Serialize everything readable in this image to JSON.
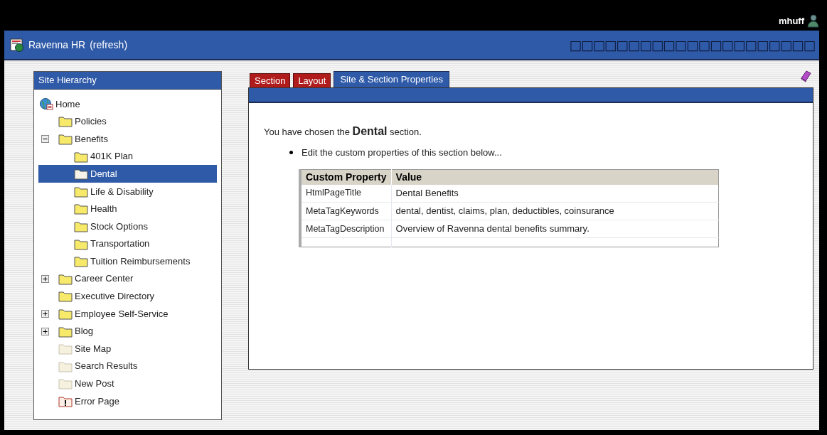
{
  "user": {
    "name": "mhuff"
  },
  "header": {
    "title": "Ravenna HR",
    "refresh_link": "(refresh)",
    "garbled_text": "□□□□□□□□□□□□□□□□□□□□□"
  },
  "sidebar": {
    "title": "Site Hierarchy",
    "tree": [
      {
        "label": "Home",
        "kind": "home",
        "selected": false,
        "children": [
          {
            "label": "Policies",
            "kind": "folder",
            "selected": false
          },
          {
            "label": "Benefits",
            "kind": "folder",
            "selected": false,
            "expanded": true,
            "children": [
              {
                "label": "401K Plan",
                "kind": "folder",
                "selected": false
              },
              {
                "label": "Dental",
                "kind": "folder",
                "selected": true
              },
              {
                "label": "Life & Disability",
                "kind": "folder",
                "selected": false
              },
              {
                "label": "Health",
                "kind": "folder",
                "selected": false
              },
              {
                "label": "Stock Options",
                "kind": "folder",
                "selected": false
              },
              {
                "label": "Transportation",
                "kind": "folder",
                "selected": false
              },
              {
                "label": "Tuition Reimbursements",
                "kind": "folder",
                "selected": false
              }
            ]
          },
          {
            "label": "Career Center",
            "kind": "folder",
            "selected": false,
            "expanded": false
          },
          {
            "label": "Executive Directory",
            "kind": "folder",
            "selected": false
          },
          {
            "label": "Employee Self-Service",
            "kind": "folder",
            "selected": false,
            "expanded": false
          },
          {
            "label": "Blog",
            "kind": "folder",
            "selected": false,
            "expanded": false
          },
          {
            "label": "Site Map",
            "kind": "page",
            "selected": false
          },
          {
            "label": "Search Results",
            "kind": "page",
            "selected": false
          },
          {
            "label": "New Post",
            "kind": "page",
            "selected": false
          },
          {
            "label": "Error Page",
            "kind": "error",
            "selected": false
          }
        ]
      }
    ]
  },
  "tabs": [
    {
      "label": "Section",
      "selected": false
    },
    {
      "label": "Layout",
      "selected": false
    },
    {
      "label": "Site & Section Properties",
      "selected": true
    }
  ],
  "content": {
    "intro": "You have chosen the **Dental** section.",
    "bullets": [
      "Edit the custom properties of this section below..."
    ],
    "table": {
      "columns": [
        "Custom Property",
        "Value"
      ],
      "rows": [
        [
          "HtmlPageTitle",
          "Dental Benefits"
        ],
        [
          "MetaTagKeywords",
          "dental, dentist, claims, plan, deductibles, coinsurance"
        ],
        [
          "MetaTagDescription",
          "Overview of Ravenna dental benefits summary."
        ]
      ]
    }
  }
}
